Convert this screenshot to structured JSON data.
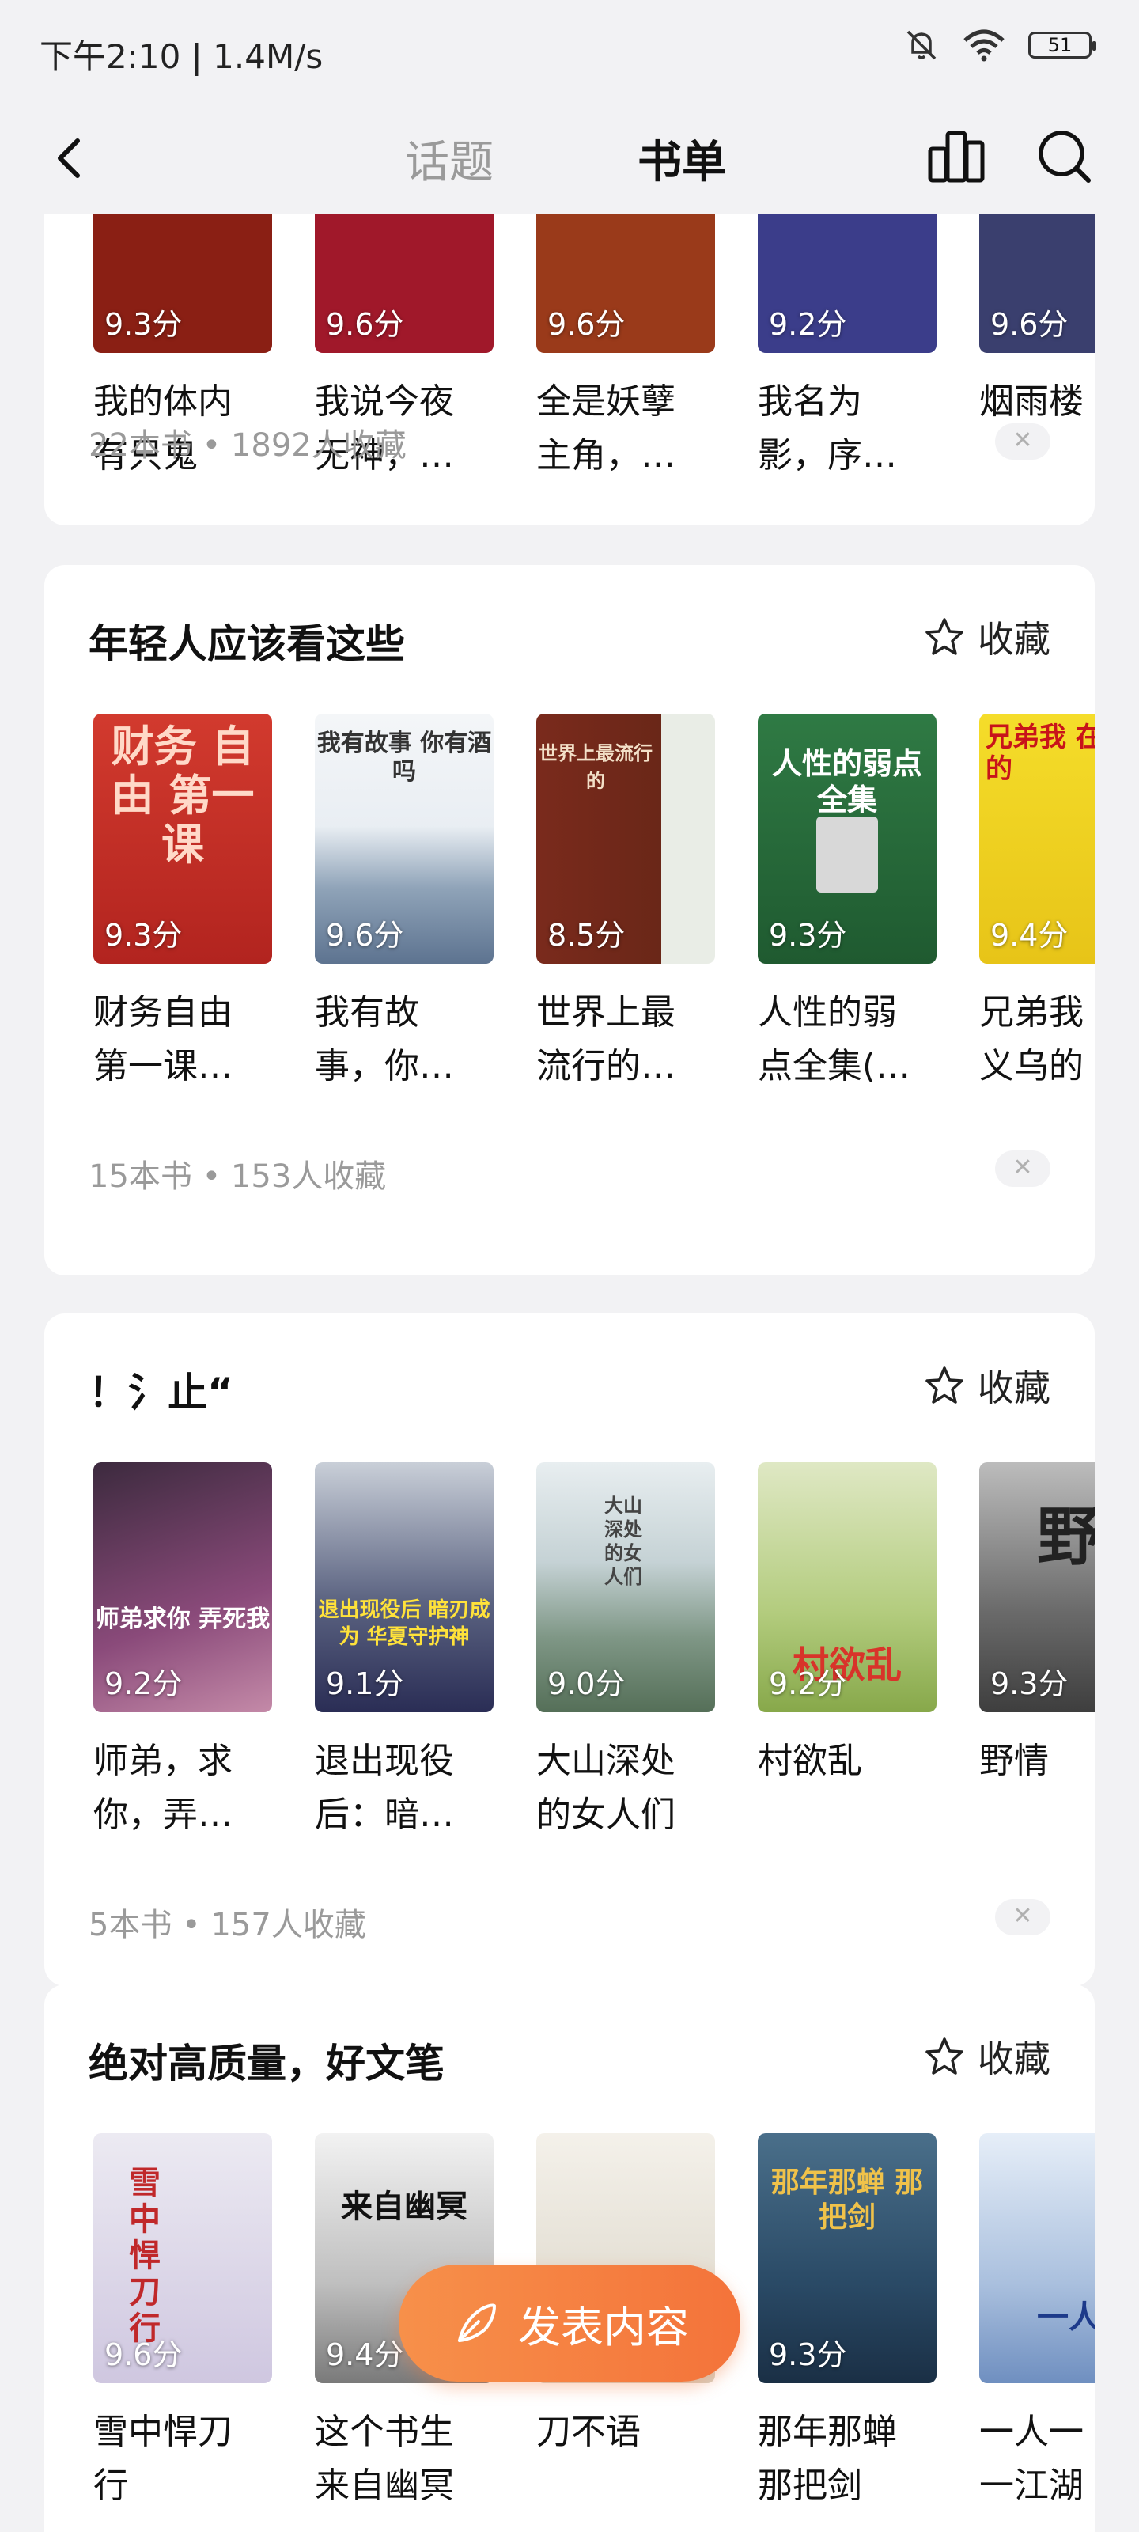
{
  "status": {
    "time": "下午2:10 | 1.4M/s",
    "battery": "51"
  },
  "nav": {
    "tabs": [
      "话题",
      "书单"
    ],
    "active_tab": "书单"
  },
  "cards": [
    {
      "title": "",
      "meta": "22本书 • 1892人收藏",
      "books": [
        {
          "score": "9.3分",
          "title": "我的体内\n有只鬼",
          "color": "#8a1f14"
        },
        {
          "score": "9.6分",
          "title": "我说今夜\n无神，…",
          "color": "#a0182a"
        },
        {
          "score": "9.6分",
          "title": "全是妖孽\n主角，…",
          "color": "#9a3a1a"
        },
        {
          "score": "9.2分",
          "title": "我名为\n影，序…",
          "color": "#3b3d8a"
        },
        {
          "score": "9.6分",
          "title": "烟雨楼",
          "color": "#3a3f6e"
        }
      ]
    },
    {
      "title": "年轻人应该看这些",
      "fav": "收藏",
      "meta": "15本书 • 153人收藏",
      "books": [
        {
          "score": "9.3分",
          "title": "财务自由\n第一课…",
          "color": "#c8302a",
          "cover_text": "财务\n自由\n第一课"
        },
        {
          "score": "9.6分",
          "title": "我有故\n事，你…",
          "color": "#7b8fa6",
          "cover_text": "我有故事\n你有酒吗"
        },
        {
          "score": "8.5分",
          "title": "世界上最\n流行的…",
          "color": "#6a3020",
          "cover_text": "世界上最流行的"
        },
        {
          "score": "9.3分",
          "title": "人性的弱\n点全集(…",
          "color": "#2d6e3a",
          "cover_text": "人性的弱点\n全集"
        },
        {
          "score": "9.4分",
          "title": "兄弟我\n义乌的",
          "color": "#e8c81e",
          "cover_text": "兄弟我\n在义乌的"
        }
      ]
    },
    {
      "title": "！氵止“",
      "fav": "收藏",
      "meta": "5本书 • 157人收藏",
      "books": [
        {
          "score": "9.2分",
          "title": "师弟，求\n你，弄…",
          "color": "#6a3a6a",
          "cover_text": "师弟求你\n弄死我"
        },
        {
          "score": "9.1分",
          "title": "退出现役\n后：暗…",
          "color": "#3a3d5a",
          "cover_text": "退出现役后\n暗刃成为\n华夏守护神"
        },
        {
          "score": "9.0分",
          "title": "大山深处\n的女人们",
          "color": "#7a9a8a",
          "cover_text": "大山深处的女人们"
        },
        {
          "score": "9.2分",
          "title": "村欲乱",
          "color": "#9fb86a",
          "cover_text": "村欲乱"
        },
        {
          "score": "9.3分",
          "title": "野情",
          "color": "#5a5a5a",
          "cover_text": "野"
        }
      ]
    },
    {
      "title": "绝对高质量，好文笔",
      "fav": "收藏",
      "meta": "",
      "books": [
        {
          "score": "9.6分",
          "title": "雪中悍刀\n行",
          "color": "#d9d6e8",
          "cover_text": "雪中悍刀行"
        },
        {
          "score": "9.4分",
          "title": "这个书生\n来自幽冥",
          "color": "#cfcfcf",
          "cover_text": "来自幽冥"
        },
        {
          "score": "",
          "title": "刀不语",
          "color": "#e6e2da",
          "cover_text": ""
        },
        {
          "score": "9.3分",
          "title": "那年那蝉\n那把剑",
          "color": "#2f4f6a",
          "cover_text": "那年那蝉\n那把剑"
        },
        {
          "score": "",
          "title": "一人一\n一江湖",
          "color": "#c9d6ea",
          "cover_text": "一人"
        }
      ]
    }
  ],
  "post_button": "发表内容"
}
